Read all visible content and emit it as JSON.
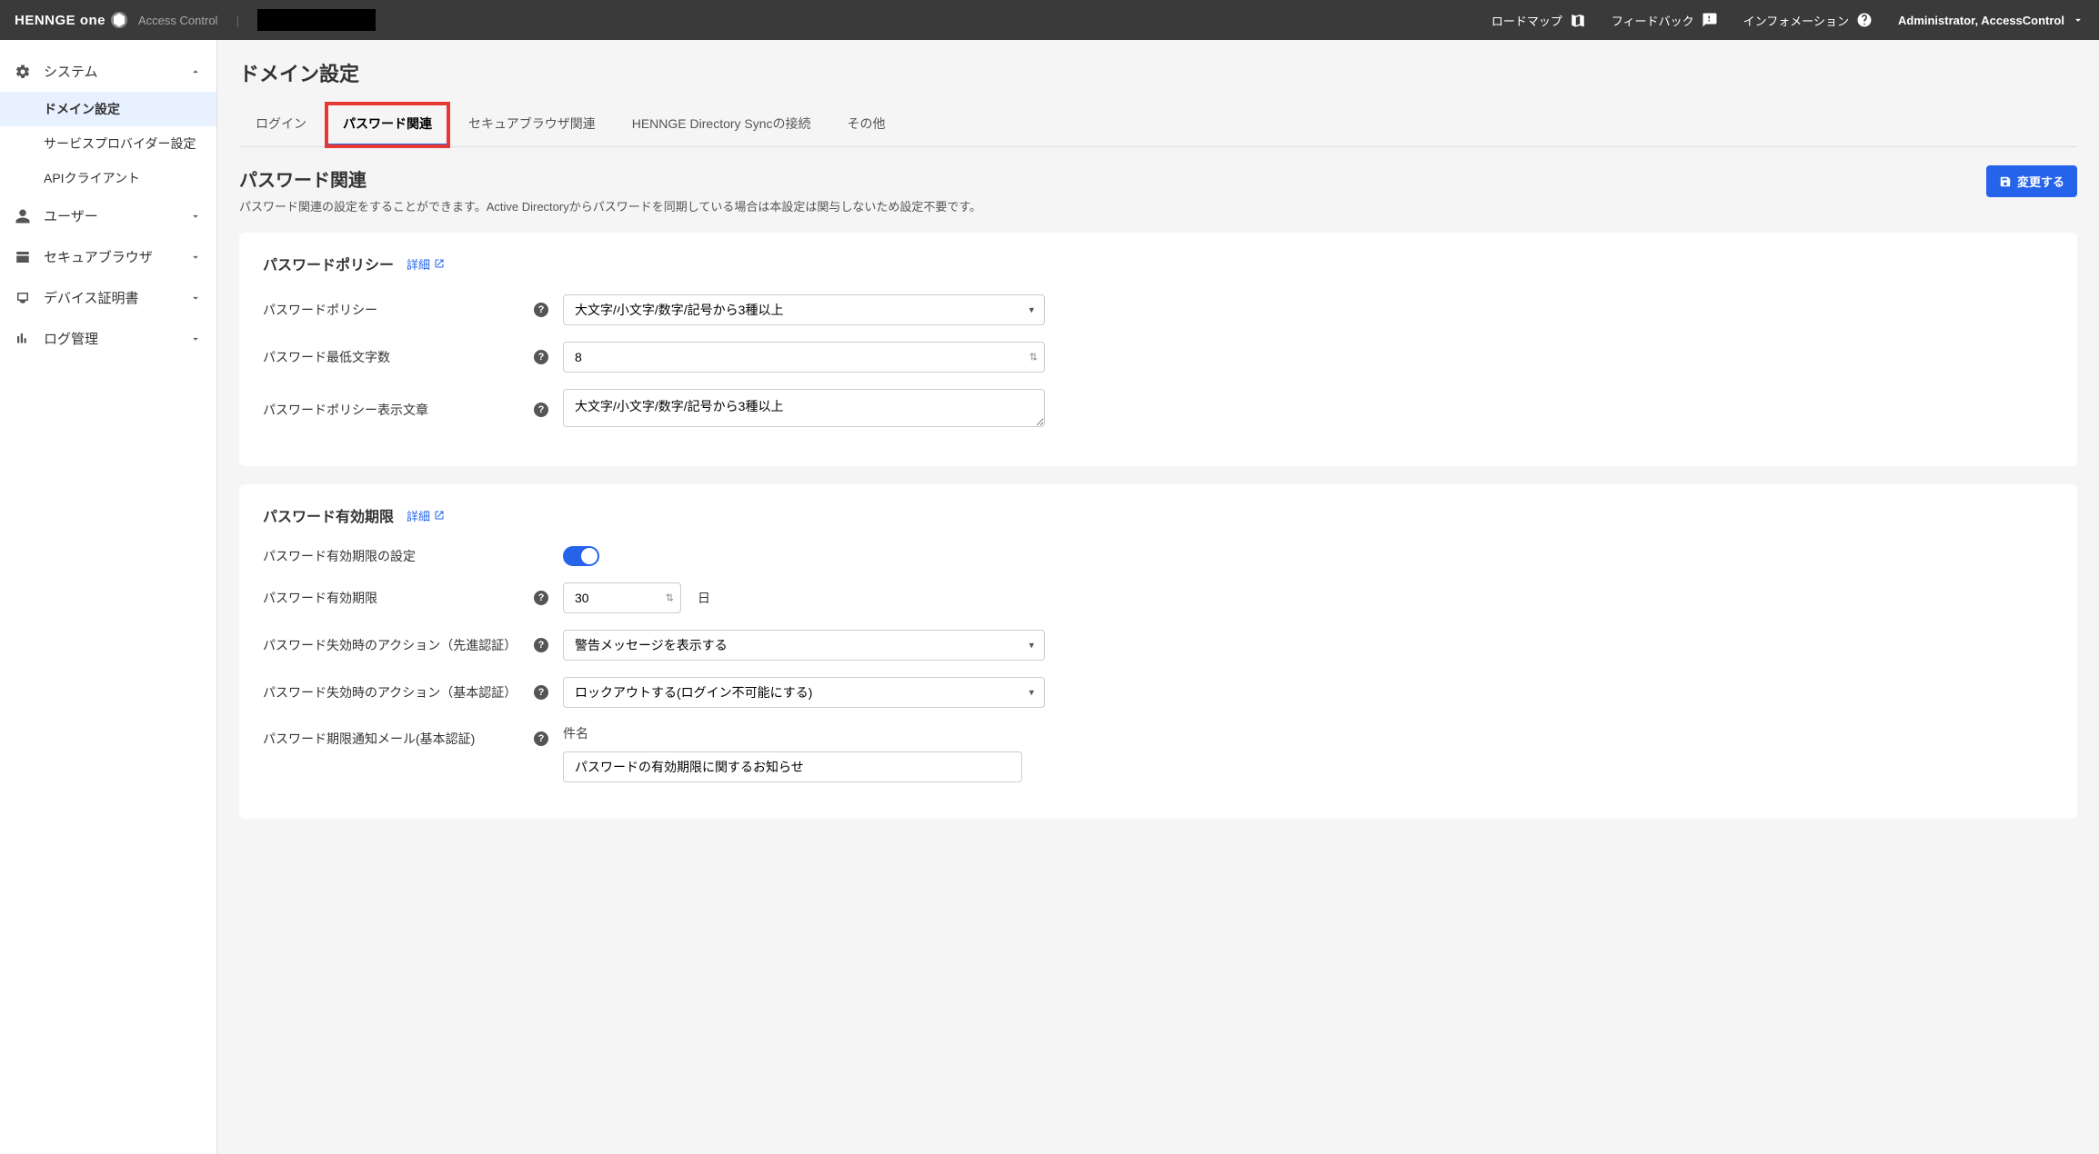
{
  "header": {
    "brand": "HENNGE one",
    "subtitle": "Access Control",
    "links": {
      "roadmap": "ロードマップ",
      "feedback": "フィードバック",
      "information": "インフォメーション"
    },
    "user": "Administrator, AccessControl"
  },
  "sidebar": {
    "system": {
      "label": "システム",
      "children": {
        "domain": "ドメイン設定",
        "sp": "サービスプロバイダー設定",
        "api": "APIクライアント"
      }
    },
    "user": {
      "label": "ユーザー"
    },
    "browser": {
      "label": "セキュアブラウザ"
    },
    "device": {
      "label": "デバイス証明書"
    },
    "log": {
      "label": "ログ管理"
    }
  },
  "page": {
    "title": "ドメイン設定",
    "tabs": {
      "login": "ログイン",
      "password": "パスワード関連",
      "browser": "セキュアブラウザ関連",
      "directory": "HENNGE Directory Syncの接続",
      "other": "その他"
    },
    "section_title": "パスワード関連",
    "section_desc": "パスワード関連の設定をすることができます。Active Directoryからパスワードを同期している場合は本設定は関与しないため設定不要です。",
    "save_button": "変更する",
    "detail_link": "詳細"
  },
  "policy": {
    "card_title": "パスワードポリシー",
    "policy_label": "パスワードポリシー",
    "policy_value": "大文字/小文字/数字/記号から3種以上",
    "minlen_label": "パスワード最低文字数",
    "minlen_value": "8",
    "display_label": "パスワードポリシー表示文章",
    "display_value": "大文字/小文字/数字/記号から3種以上"
  },
  "expiry": {
    "card_title": "パスワード有効期限",
    "enable_label": "パスワード有効期限の設定",
    "period_label": "パスワード有効期限",
    "period_value": "30",
    "period_unit": "日",
    "action_adv_label": "パスワード失効時のアクション（先進認証）",
    "action_adv_value": "警告メッセージを表示する",
    "action_basic_label": "パスワード失効時のアクション（基本認証）",
    "action_basic_value": "ロックアウトする(ログイン不可能にする)",
    "notify_label": "パスワード期限通知メール(基本認証)",
    "subject_label": "件名",
    "subject_value": "パスワードの有効期限に関するお知らせ"
  }
}
